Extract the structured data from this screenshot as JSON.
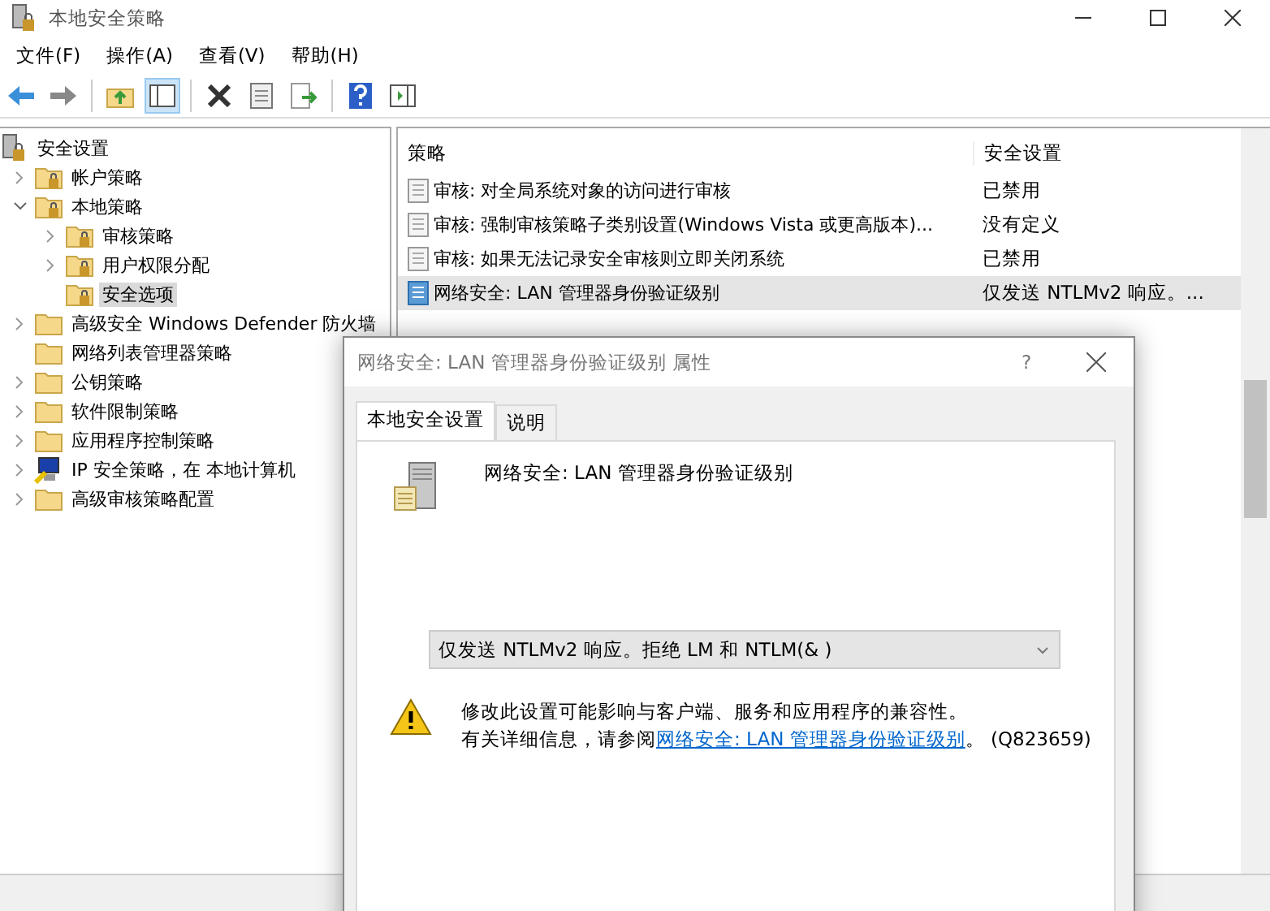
{
  "window": {
    "title": "本地安全策略"
  },
  "menu": [
    "文件(F)",
    "操作(A)",
    "查看(V)",
    "帮助(H)"
  ],
  "tree": [
    {
      "label": "安全设置",
      "kind": "root",
      "selected": false,
      "children": [
        {
          "label": "帐户策略",
          "kind": "folder",
          "expanded": false,
          "selected": false
        },
        {
          "label": "本地策略",
          "kind": "folder",
          "expanded": true,
          "selected": false,
          "children": [
            {
              "label": "审核策略",
              "kind": "folder",
              "expanded": false,
              "selected": false
            },
            {
              "label": "用户权限分配",
              "kind": "folder",
              "expanded": false,
              "selected": false
            },
            {
              "label": "安全选项",
              "kind": "folder",
              "selected": true
            }
          ]
        },
        {
          "label": "高级安全 Windows Defender 防火墙",
          "kind": "plain",
          "expanded": false,
          "selected": false
        },
        {
          "label": "网络列表管理器策略",
          "kind": "plain",
          "selected": false
        },
        {
          "label": "公钥策略",
          "kind": "plain",
          "expanded": false,
          "selected": false
        },
        {
          "label": "软件限制策略",
          "kind": "plain",
          "expanded": false,
          "selected": false
        },
        {
          "label": "应用程序控制策略",
          "kind": "plain",
          "expanded": false,
          "selected": false
        },
        {
          "label": "IP 安全策略，在 本地计算机",
          "kind": "network",
          "expanded": false,
          "selected": false
        },
        {
          "label": "高级审核策略配置",
          "kind": "plain",
          "expanded": false,
          "selected": false
        }
      ]
    }
  ],
  "table": {
    "columns": [
      "策略",
      "安全设置"
    ],
    "rows": [
      {
        "policy": "审核: 对全局系统对象的访问进行审核",
        "setting": "已禁用",
        "selected": false
      },
      {
        "policy": "审核: 强制审核策略子类别设置(Windows Vista 或更高版本)...",
        "setting": "没有定义",
        "selected": false
      },
      {
        "policy": "审核: 如果无法记录安全审核则立即关闭系统",
        "setting": "已禁用",
        "selected": false
      },
      {
        "policy": "网络安全: LAN 管理器身份验证级别",
        "setting": "仅发送 NTLMv2 响应。...",
        "selected": true
      }
    ]
  },
  "dialog": {
    "title": "网络安全: LAN 管理器身份验证级别 属性",
    "help": "?",
    "tabs": [
      {
        "label": "本地安全设置",
        "selected": true
      },
      {
        "label": "说明",
        "selected": false
      }
    ],
    "heading": "网络安全: LAN 管理器身份验证级别",
    "dropdown": {
      "value": "仅发送 NTLMv2 响应。拒绝 LM 和 NTLM(& )"
    },
    "warning": "修改此设置可能影响与客户端、服务和应用程序的兼容性。",
    "info_prefix": "有关详细信息，请参阅",
    "info_link": "网络安全: LAN 管理器身份验证级别",
    "info_suffix": "。 (Q823659)"
  }
}
